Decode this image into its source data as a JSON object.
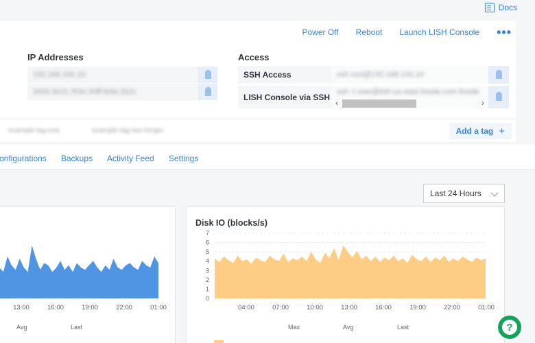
{
  "header": {
    "docs_label": "Docs"
  },
  "actions": {
    "power_off": "Power Off",
    "reboot": "Reboot",
    "launch_lish": "Launch LISH Console",
    "more": "•••"
  },
  "ip_section": {
    "title": "IP Addresses",
    "rows": [
      "192.168.100.10",
      "2600:3c01::f03c:93ff:fe8a:1b2c"
    ]
  },
  "access_section": {
    "title": "Access",
    "ssh_label": "SSH Access",
    "ssh_value": "ssh root@192.168.100.10",
    "lish_label": "LISH Console via SSH",
    "lish_value": "ssh -t user@lish-us-east.linode.com linode"
  },
  "tags": {
    "items": [
      "example-tag-one",
      "example-tag-two-longer"
    ],
    "add_label": "Add a tag"
  },
  "tabs": [
    "onfigurations",
    "Backups",
    "Activity Feed",
    "Settings"
  ],
  "range_select": {
    "value": "Last 24 Hours"
  },
  "cpu_card": {
    "x_ticks": [
      "13:00",
      "16:00",
      "19:00",
      "22:00",
      "01:00"
    ],
    "stat_headers": [
      "Avg",
      "Last"
    ],
    "color": "#5095e4"
  },
  "disk_card": {
    "title": "Disk IO (blocks/s)",
    "stat_headers": [
      "Max",
      "Avg",
      "Last"
    ],
    "color": "#fecd85"
  },
  "chart_data": [
    {
      "type": "area",
      "title": "",
      "x": [
        "13:00",
        "16:00",
        "19:00",
        "22:00",
        "01:00"
      ],
      "series": [
        {
          "values": [
            1.4,
            1.2,
            1.9,
            1.5,
            1.3,
            1.8,
            1.4,
            1.2,
            2.4,
            1.8,
            1.3,
            1.6,
            1.5,
            1.2,
            1.4,
            1.7,
            1.3,
            1.5,
            1.2,
            1.6,
            1.4,
            1.3,
            1.5,
            1.7,
            1.4,
            1.2,
            1.5,
            1.3,
            1.8,
            1.4,
            1.3,
            1.5,
            1.6,
            1.4,
            1.3,
            1.7,
            1.5,
            1.4,
            1.9,
            1.6
          ]
        }
      ]
    },
    {
      "type": "area",
      "title": "Disk IO (blocks/s)",
      "x": [
        "04:00",
        "07:00",
        "10:00",
        "13:00",
        "16:00",
        "19:00",
        "22:00",
        "01:00"
      ],
      "ylim": [
        0,
        7
      ],
      "yticks": [
        0,
        1,
        2,
        3,
        4,
        5,
        6,
        7
      ],
      "series": [
        {
          "values": [
            4.3,
            3.9,
            4.5,
            4.1,
            3.8,
            4.6,
            4.0,
            4.2,
            3.7,
            4.4,
            4.1,
            3.9,
            4.6,
            4.2,
            4.0,
            4.8,
            3.9,
            4.3,
            4.1,
            4.5,
            4.0,
            5.0,
            4.2,
            3.8,
            4.9,
            4.3,
            5.4,
            4.1,
            5.7,
            5.0,
            4.4,
            5.1,
            4.2,
            4.6,
            4.0,
            4.5,
            3.9,
            4.4,
            4.1,
            4.6,
            4.0,
            4.3,
            3.8,
            4.7,
            4.2,
            4.0,
            4.5,
            3.9,
            4.4,
            4.1,
            4.6,
            3.9,
            4.3,
            4.0,
            4.5,
            4.2,
            3.9,
            4.4,
            4.1,
            4.3
          ]
        }
      ]
    }
  ]
}
